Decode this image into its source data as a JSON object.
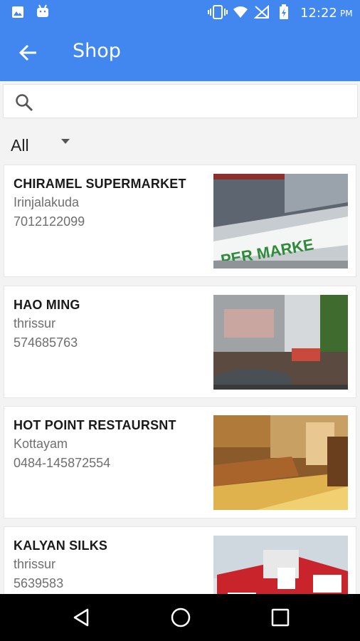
{
  "status_bar": {
    "time": "12:22",
    "ampm": "PM"
  },
  "app_bar": {
    "title": "Shop"
  },
  "search": {
    "placeholder": ""
  },
  "filter": {
    "selected": "All"
  },
  "shops": [
    {
      "name": "CHIRAMEL SUPERMARKET",
      "city": "Irinjalakuda",
      "phone": "7012122099",
      "image_sign_text": "PER MARKE"
    },
    {
      "name": "HAO MING",
      "city": "thrissur",
      "phone": "574685763",
      "image_sign_text": ""
    },
    {
      "name": "HOT POINT RESTAURSNT",
      "city": "Kottayam",
      "phone": "0484-145872554",
      "image_sign_text": ""
    },
    {
      "name": "KALYAN SILKS",
      "city": "thrissur",
      "phone": "5639583",
      "image_sign_text": ""
    }
  ],
  "colors": {
    "primary": "#4287f0",
    "list_background": "#f3f3f3",
    "card_background": "#ffffff"
  }
}
